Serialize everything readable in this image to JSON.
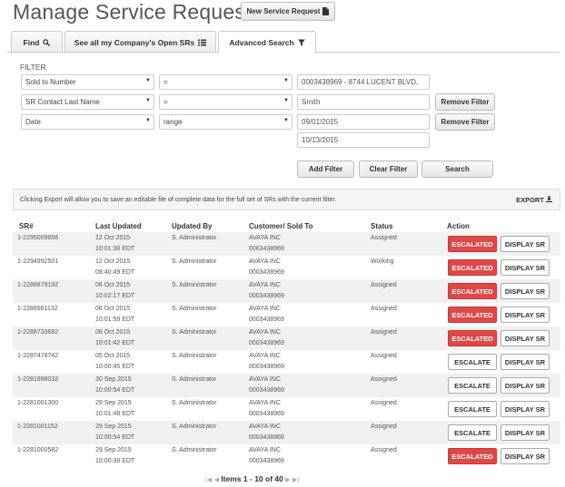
{
  "header": {
    "title": "Manage Service Requests",
    "new_button": "New Service Request"
  },
  "tabs": [
    {
      "label": "Find"
    },
    {
      "label": "See all my Company's Open SRs"
    },
    {
      "label": "Advanced Search"
    }
  ],
  "filter": {
    "section_label": "FILTER",
    "rows": [
      {
        "field": "Sold to Number",
        "operator": "=",
        "value": "0003438969 - 8744 LUCENT BLVD,"
      },
      {
        "field": "SR Contact Last Name",
        "operator": "=",
        "value": "Smith",
        "remove_label": "Remove Filter"
      },
      {
        "field": "Date",
        "operator": "range",
        "value": "09/01/2015",
        "value2": "10/13/2015",
        "remove_label": "Remove Filter"
      }
    ],
    "add_label": "Add Filter",
    "clear_label": "Clear Filter",
    "search_label": "Search"
  },
  "notice": {
    "text": "Clicking Export will allow you to save an editable file of complete data for the full set of SRs with the current filter.",
    "export_label": "EXPORT"
  },
  "table": {
    "headers": {
      "sr": "SR#",
      "last_updated": "Last Updated",
      "updated_by": "Updated By",
      "customer": "Customer/ Sold To",
      "status": "Status",
      "action": "Action"
    },
    "rows": [
      {
        "sr": "1-2295009656",
        "date": "12 Oct 2015",
        "time": "10:01:30 EDT",
        "by": "S. Administrator",
        "customer": "AVAYA INC",
        "sold_to": "0003438969",
        "status": "Assigned",
        "action": "ESCALATED",
        "escalated": true,
        "display": "DISPLAY SR"
      },
      {
        "sr": "1-2294992501",
        "date": "12 Oct 2015",
        "time": "08:40:49 EDT",
        "by": "S. Administrator",
        "customer": "AVAYA INC",
        "sold_to": "0003438969",
        "status": "Working",
        "action": "ESCALATED",
        "escalated": true,
        "display": "DISPLAY SR"
      },
      {
        "sr": "1-2288879192",
        "date": "06 Oct 2015",
        "time": "10:02:17 EDT",
        "by": "S. Administrator",
        "customer": "AVAYA INC",
        "sold_to": "0003438969",
        "status": "Assigned",
        "action": "ESCALATED",
        "escalated": true,
        "display": "DISPLAY SR"
      },
      {
        "sr": "1-2288561132",
        "date": "06 Oct 2015",
        "time": "10:01:59 EDT",
        "by": "S. Administrator",
        "customer": "AVAYA INC",
        "sold_to": "0003438969",
        "status": "Assigned",
        "action": "ESCALATED",
        "escalated": true,
        "display": "DISPLAY SR"
      },
      {
        "sr": "1-2288733682",
        "date": "06 Oct 2015",
        "time": "10:01:42 EDT",
        "by": "S. Administrator",
        "customer": "AVAYA INC",
        "sold_to": "0003438969",
        "status": "Assigned",
        "action": "ESCALATED",
        "escalated": true,
        "display": "DISPLAY SR"
      },
      {
        "sr": "1-2287478742",
        "date": "05 Oct 2015",
        "time": "10:00:45 EDT",
        "by": "S. Administrator",
        "customer": "AVAYA INC",
        "sold_to": "0003438969",
        "status": "Assigned",
        "action": "ESCALATE",
        "escalated": false,
        "display": "DISPLAY SR"
      },
      {
        "sr": "1-2281988032",
        "date": "30 Sep 2015",
        "time": "10:00:54 EDT",
        "by": "S. Administrator",
        "customer": "AVAYA INC",
        "sold_to": "0003438969",
        "status": "Assigned",
        "action": "ESCALATE",
        "escalated": false,
        "display": "DISPLAY SR"
      },
      {
        "sr": "1-2281001300",
        "date": "29 Sep 2015",
        "time": "10:01:48 EDT",
        "by": "S. Administrator",
        "customer": "AVAYA INC",
        "sold_to": "0003438969",
        "status": "Assigned",
        "action": "ESCALATE",
        "escalated": false,
        "display": "DISPLAY SR"
      },
      {
        "sr": "1-2281001152",
        "date": "29 Sep 2015",
        "time": "10:00:54 EDT",
        "by": "S. Administrator",
        "customer": "AVAYA INC",
        "sold_to": "0003438969",
        "status": "Assigned",
        "action": "ESCALATE",
        "escalated": false,
        "display": "DISPLAY SR"
      },
      {
        "sr": "1-2281000582",
        "date": "29 Sep 2015",
        "time": "10:00:38 EDT",
        "by": "S. Administrator",
        "customer": "AVAYA INC",
        "sold_to": "0003438969",
        "status": "Assigned",
        "action": "ESCALATED",
        "escalated": true,
        "display": "DISPLAY SR"
      }
    ]
  },
  "pagination": {
    "label": "Items 1 - 10 of 40"
  },
  "colors": {
    "escalated": "#e04848",
    "row_alt": "#f1f1f1"
  }
}
